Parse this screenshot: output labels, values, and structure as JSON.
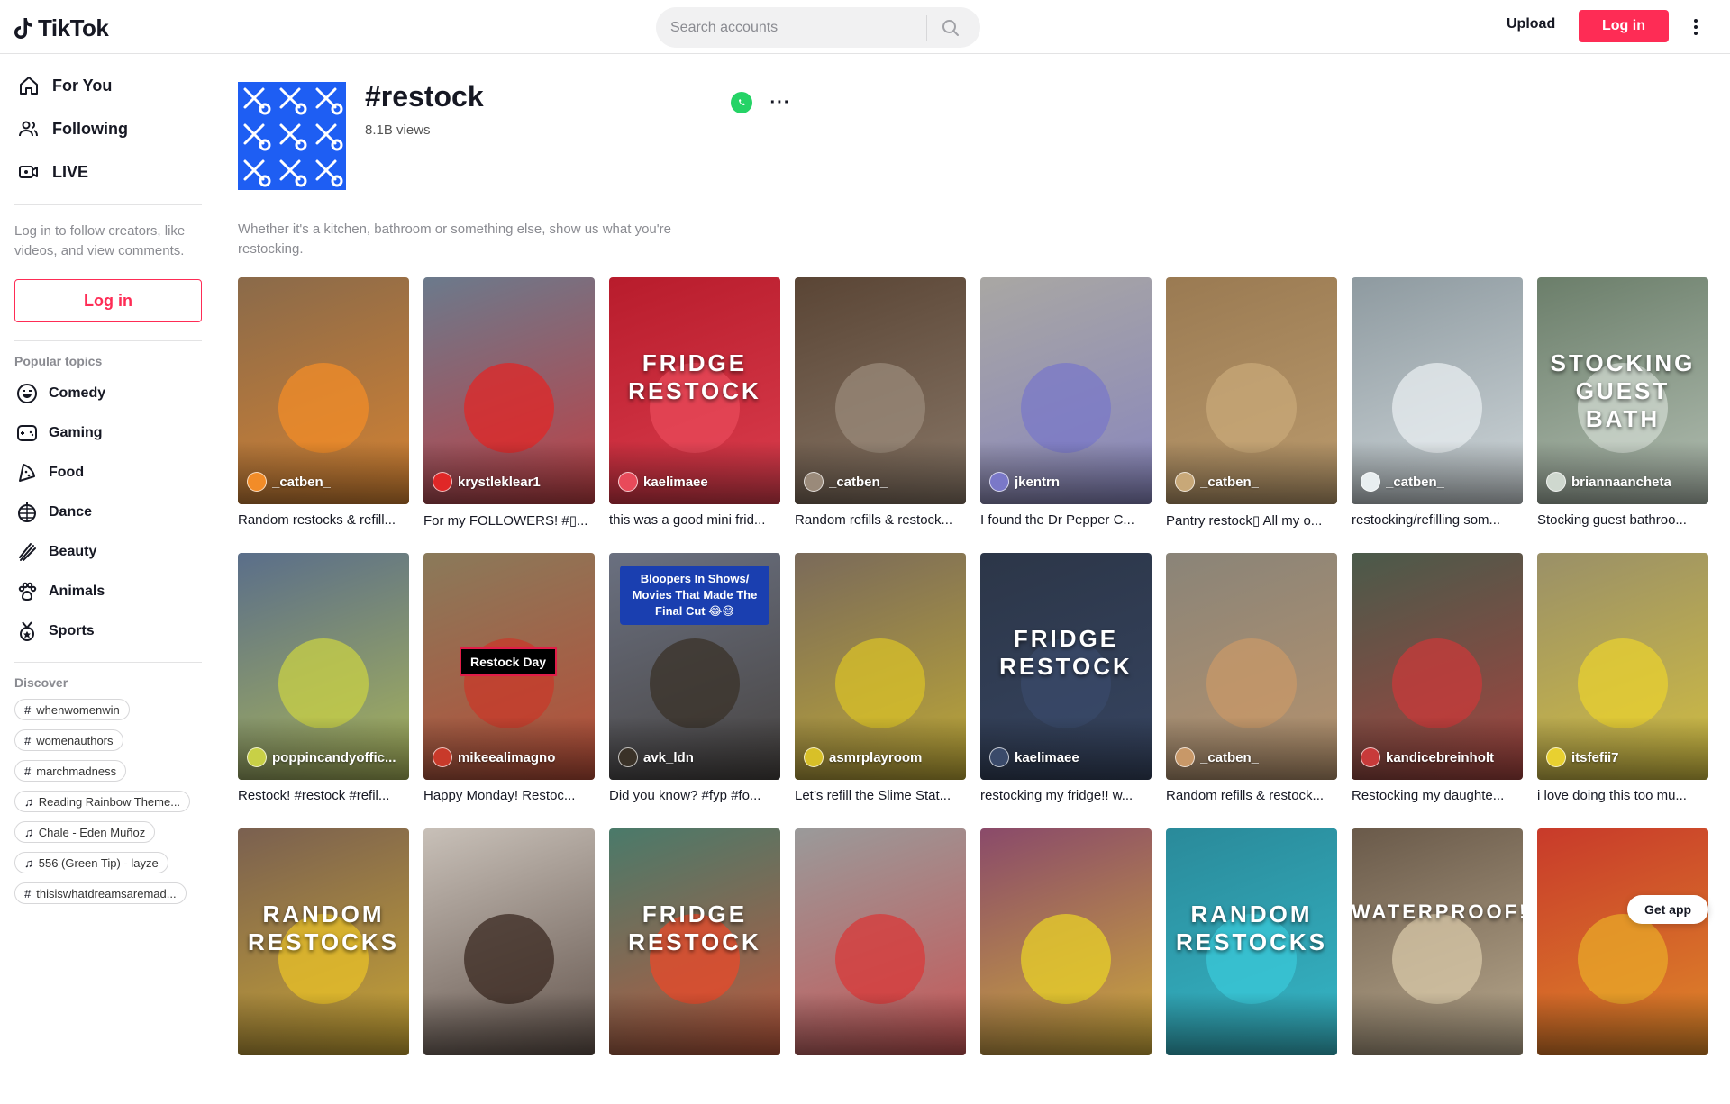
{
  "header": {
    "logo_text": "TikTok",
    "search_placeholder": "Search accounts",
    "upload_label": "Upload",
    "login_label": "Log in"
  },
  "sidebar": {
    "nav": [
      {
        "label": "For You",
        "icon": "home-icon"
      },
      {
        "label": "Following",
        "icon": "users-icon"
      },
      {
        "label": "LIVE",
        "icon": "live-icon"
      }
    ],
    "login_hint": "Log in to follow creators, like videos, and view comments.",
    "login_button": "Log in",
    "popular_title": "Popular topics",
    "topics": [
      {
        "label": "Comedy",
        "icon": "comedy-icon"
      },
      {
        "label": "Gaming",
        "icon": "gaming-icon"
      },
      {
        "label": "Food",
        "icon": "food-icon"
      },
      {
        "label": "Dance",
        "icon": "dance-icon"
      },
      {
        "label": "Beauty",
        "icon": "beauty-icon"
      },
      {
        "label": "Animals",
        "icon": "animals-icon"
      },
      {
        "label": "Sports",
        "icon": "sports-icon"
      }
    ],
    "discover_title": "Discover",
    "discover": [
      {
        "label": "whenwomenwin",
        "type": "hashtag"
      },
      {
        "label": "womenauthors",
        "type": "hashtag"
      },
      {
        "label": "marchmadness",
        "type": "hashtag"
      },
      {
        "label": "Reading Rainbow Theme...",
        "type": "music"
      },
      {
        "label": "Chale - Eden Muñoz",
        "type": "music"
      },
      {
        "label": "556 (Green Tip) - layze",
        "type": "music"
      },
      {
        "label": "thisiswhatdreamsaremad...",
        "type": "hashtag"
      }
    ]
  },
  "tag_page": {
    "title": "#restock",
    "views": "8.1B views",
    "description": "Whether it's a kitchen, bathroom or something else, show us what you're restocking."
  },
  "videos": [
    {
      "author": "_catben_",
      "caption": "Random restocks & refill...",
      "bg": "#8a6a4a",
      "accent": "#f28c28",
      "overlay": ""
    },
    {
      "author": "krystleklear1",
      "caption": "For my FOLLOWERS! #▯...",
      "bg": "#6b7a8c",
      "accent": "#e02727",
      "overlay": ""
    },
    {
      "author": "kaelimaee",
      "caption": "this was a good mini frid...",
      "bg": "#b81c2c",
      "accent": "#e84a5a",
      "overlay": "FRIDGE RESTOCK"
    },
    {
      "author": "_catben_",
      "caption": "Random refills & restock...",
      "bg": "#5a4535",
      "accent": "#9a8a7a",
      "overlay": ""
    },
    {
      "author": "jkentrn",
      "caption": "I found the Dr Pepper C...",
      "bg": "#a9a7a3",
      "accent": "#7a78c8",
      "overlay": ""
    },
    {
      "author": "_catben_",
      "caption": "Pantry restock▯ All my o...",
      "bg": "#9a7a52",
      "accent": "#c8a878",
      "overlay": ""
    },
    {
      "author": "_catben_",
      "caption": "restocking/refilling som...",
      "bg": "#8e9aa0",
      "accent": "#e8eef0",
      "overlay": ""
    },
    {
      "author": "briannaancheta",
      "caption": "Stocking guest bathroo...",
      "bg": "#6b7e6a",
      "accent": "#cfd8cf",
      "overlay": "STOCKING GUEST BATH"
    },
    {
      "author": "poppincandyoffic...",
      "caption": "Restock! #restock #refil...",
      "bg": "#5a6e8a",
      "accent": "#c8d046",
      "overlay": ""
    },
    {
      "author": "mikeealimagno",
      "caption": "Happy Monday! Restoc...",
      "bg": "#8a7a5a",
      "accent": "#c83a2a",
      "overlay": "Restock Day"
    },
    {
      "author": "avk_ldn",
      "caption": "Did you know? #fyp #fo...",
      "bg": "#6a7080",
      "accent": "#3a3228",
      "overlay": "Bloopers In Shows/ Movies That Made The Final Cut 😂😅"
    },
    {
      "author": "asmrplayroom",
      "caption": "Let’s refill the Slime Stat...",
      "bg": "#7a6a5a",
      "accent": "#d8c028",
      "overlay": ""
    },
    {
      "author": "kaelimaee",
      "caption": "restocking my fridge!! w...",
      "bg": "#2c3648",
      "accent": "#3a4a6a",
      "overlay": "FRIDGE RESTOCK"
    },
    {
      "author": "_catben_",
      "caption": "Random refills & restock...",
      "bg": "#8a8478",
      "accent": "#c89868",
      "overlay": ""
    },
    {
      "author": "kandicebreinholt",
      "caption": "Restocking my daughte...",
      "bg": "#4a5a4a",
      "accent": "#c83a3a",
      "overlay": ""
    },
    {
      "author": "itsfefii7",
      "caption": "i love doing this too mu...",
      "bg": "#9a9068",
      "accent": "#e8d030",
      "overlay": ""
    },
    {
      "author": "",
      "caption": "",
      "bg": "#7a6050",
      "accent": "#e8c028",
      "overlay": "RANDOM RESTOCKS"
    },
    {
      "author": "",
      "caption": "",
      "bg": "#c8c0b8",
      "accent": "#3a2820",
      "overlay": ""
    },
    {
      "author": "",
      "caption": "",
      "bg": "#4a7a6a",
      "accent": "#e84a2a",
      "overlay": "FRIDGE RESTOCK"
    },
    {
      "author": "",
      "caption": "",
      "bg": "#9a9a9a",
      "accent": "#d83a3a",
      "overlay": ""
    },
    {
      "author": "",
      "caption": "",
      "bg": "#8a4a6a",
      "accent": "#e8d028",
      "overlay": ""
    },
    {
      "author": "",
      "caption": "",
      "bg": "#2a8a9a",
      "accent": "#3ac8d8",
      "overlay": "RANDOM RESTOCKS"
    },
    {
      "author": "",
      "caption": "",
      "bg": "#6a5a4a",
      "accent": "#d8c8a8",
      "overlay": "WATERPROOF!"
    },
    {
      "author": "",
      "caption": "",
      "bg": "#c83a2a",
      "accent": "#e8a828",
      "overlay": ""
    }
  ],
  "get_app": "Get app",
  "colors": {
    "brand": "#fe2c55",
    "tag_cover": "#1e5ef3"
  }
}
